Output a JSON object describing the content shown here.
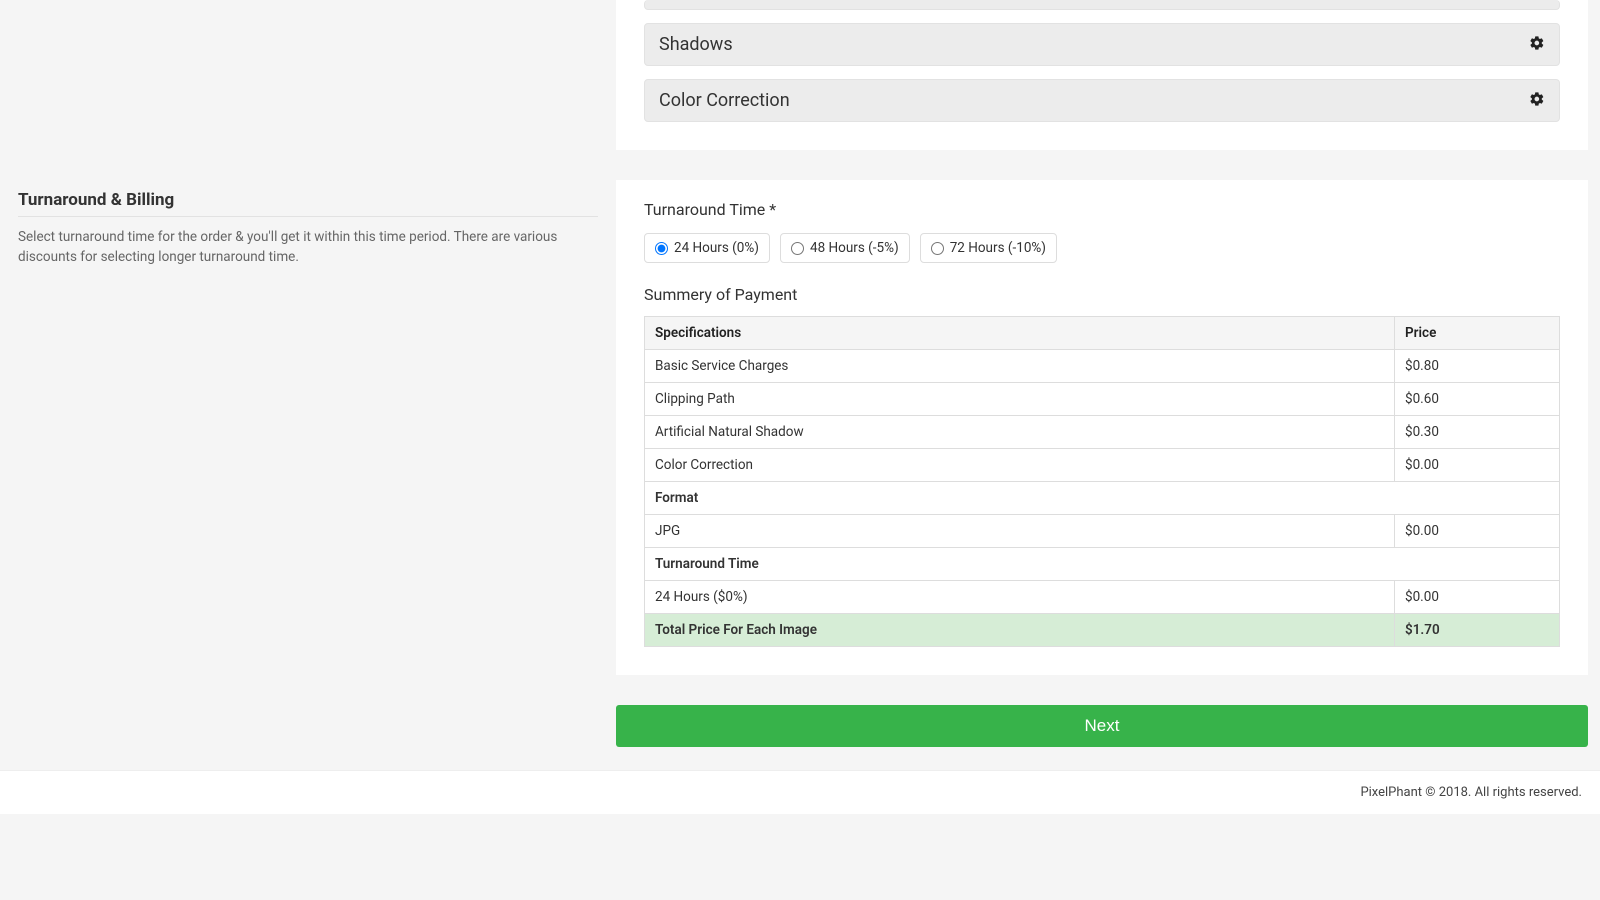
{
  "accordions": {
    "shadows": "Shadows",
    "color_correction": "Color Correction"
  },
  "left": {
    "title": "Turnaround & Billing",
    "desc": "Select turnaround time for the order & you'll get it within this time period. There are various discounts for selecting longer turnaround time."
  },
  "turnaround": {
    "label": "Turnaround Time *",
    "options": {
      "opt24": "24 Hours (0%)",
      "opt48": "48 Hours (-5%)",
      "opt72": "72 Hours (-10%)"
    }
  },
  "summary": {
    "title": "Summery of Payment",
    "headers": {
      "spec": "Specifications",
      "price": "Price"
    },
    "rows": {
      "basic": {
        "label": "Basic Service Charges",
        "price": "$0.80"
      },
      "clip": {
        "label": "Clipping Path",
        "price": "$0.60"
      },
      "shadow": {
        "label": "Artificial Natural Shadow",
        "price": "$0.30"
      },
      "cc": {
        "label": "Color Correction",
        "price": "$0.00"
      },
      "format_hdr": "Format",
      "jpg": {
        "label": "JPG",
        "price": "$0.00"
      },
      "tat_hdr": "Turnaround Time",
      "tat": {
        "label": "24 Hours ($0%)",
        "price": "$0.00"
      },
      "total": {
        "label": "Total Price For Each Image",
        "price": "$1.70"
      }
    }
  },
  "next_label": "Next",
  "footer": "PixelPhant © 2018. All rights reserved."
}
